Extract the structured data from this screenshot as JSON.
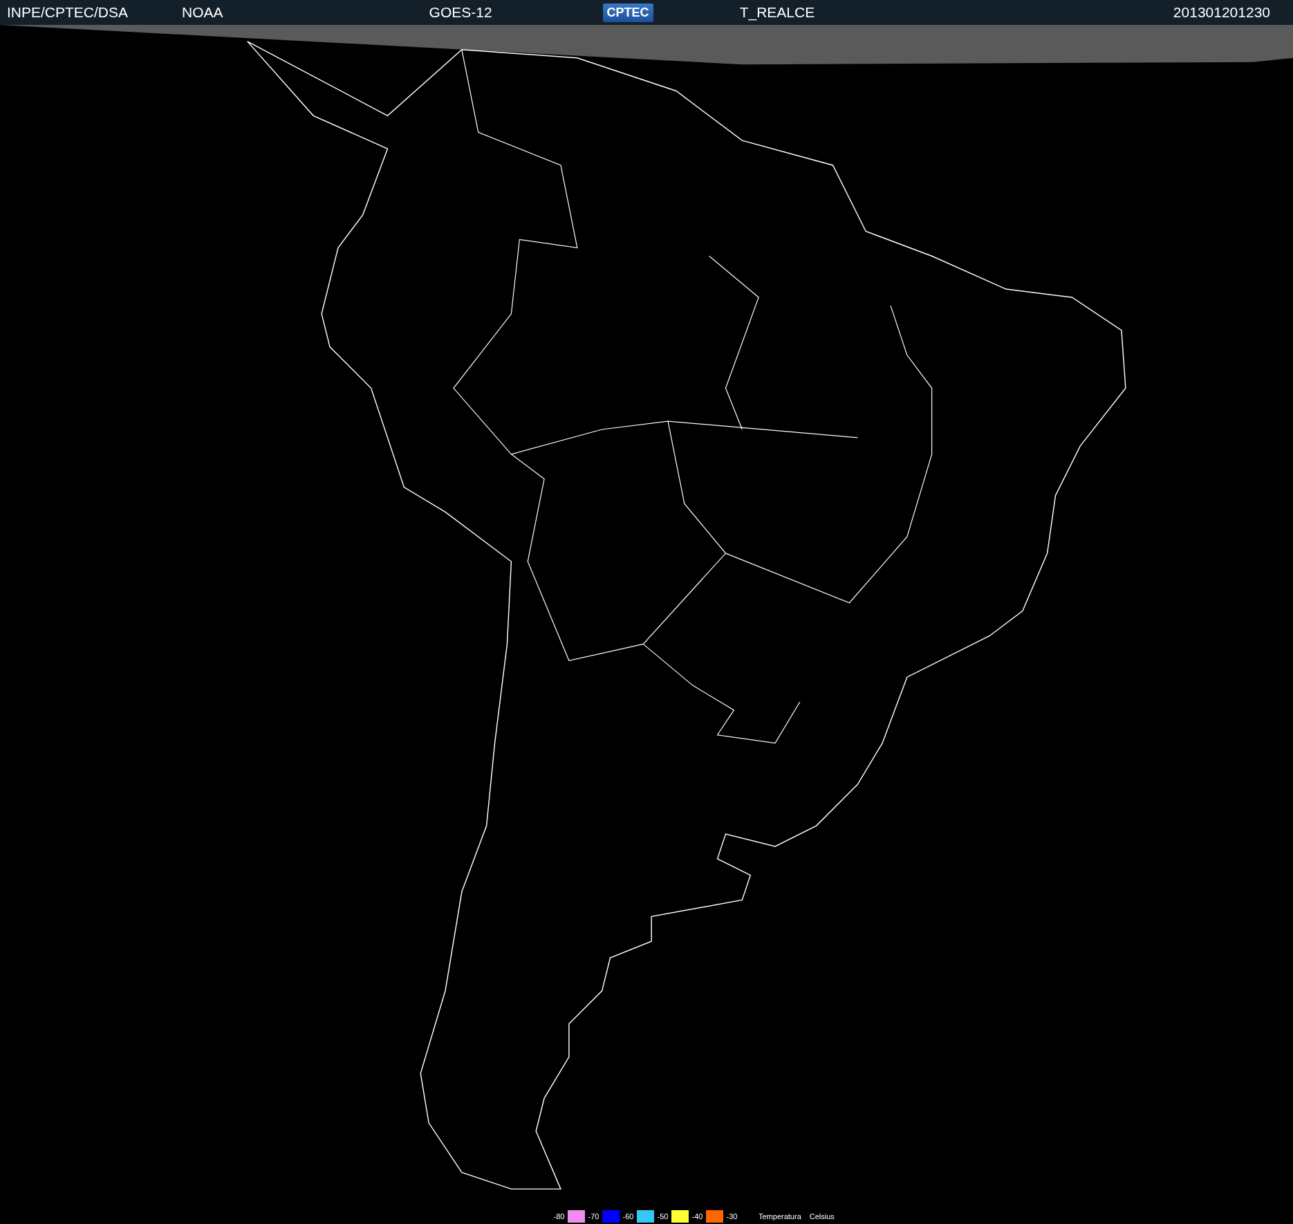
{
  "header": {
    "source": "INPE/CPTEC/DSA",
    "agency": "NOAA",
    "satellite": "GOES-12",
    "logo": "CPTEC",
    "product": "T_REALCE",
    "timestamp": "201301201230"
  },
  "legend": {
    "items": [
      {
        "label": "-80",
        "color": "#f08cf0"
      },
      {
        "label": "-70",
        "color": "#0000ff"
      },
      {
        "label": "-60",
        "color": "#33c8f5"
      },
      {
        "label": "-50",
        "color": "#ffff33"
      },
      {
        "label": "-40",
        "color": "#ff6600"
      },
      {
        "label": "-30"
      }
    ],
    "title": "Temperatura",
    "unit": "Celsius"
  }
}
